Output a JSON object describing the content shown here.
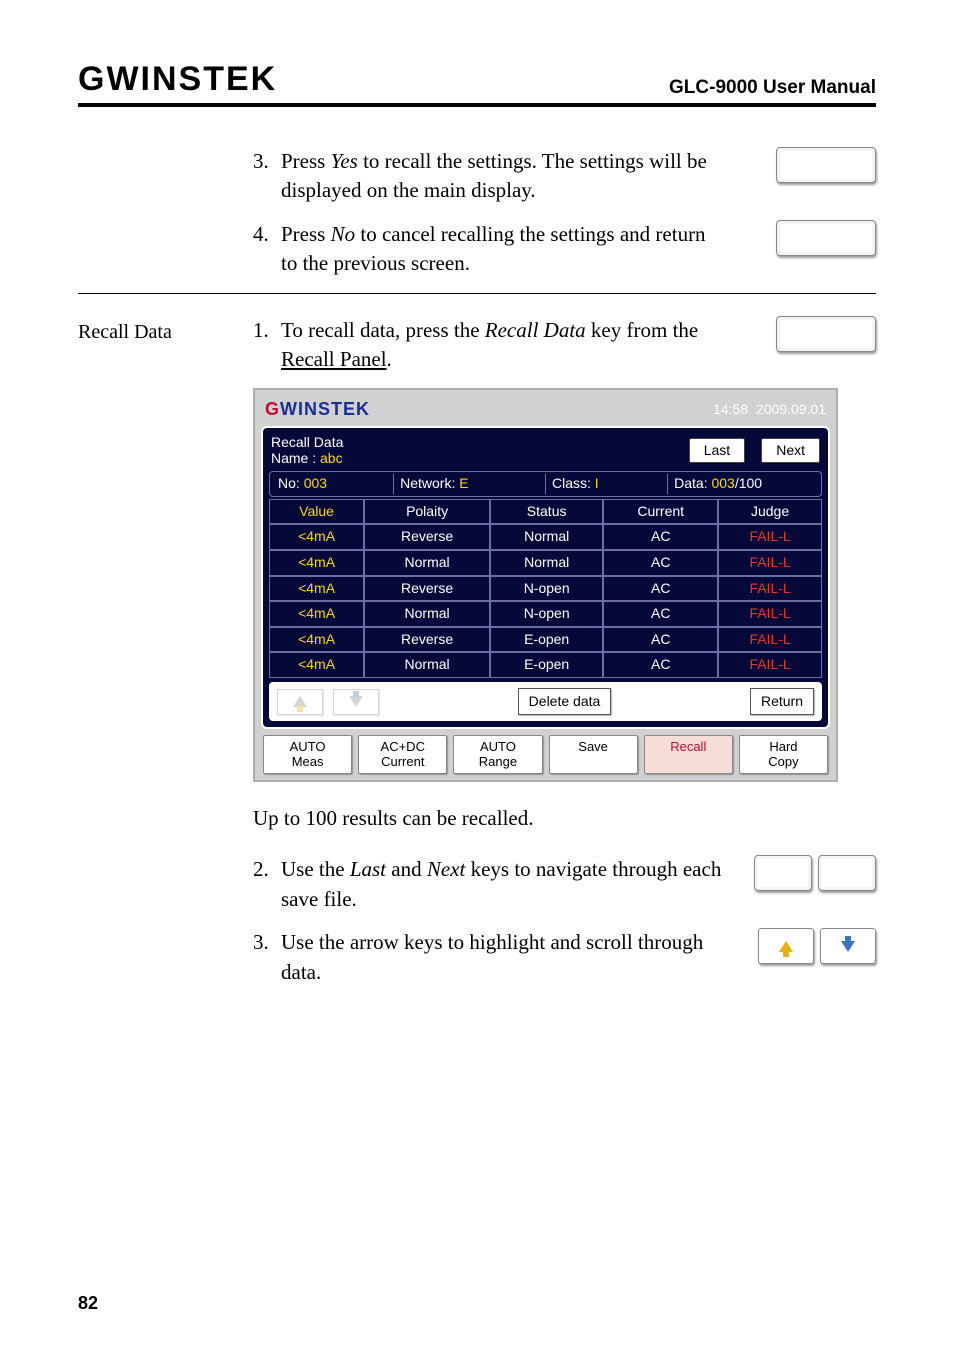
{
  "header": {
    "logo": "GWINSTEK",
    "manual": "GLC-9000 User Manual"
  },
  "step3": {
    "num": "3.",
    "text_a": "Press ",
    "yes": "Yes",
    "text_b": " to recall the settings. The settings will be displayed on the main display."
  },
  "step4": {
    "num": "4.",
    "text_a": "Press ",
    "no": "No",
    "text_b": " to cancel recalling the settings and return to the previous screen."
  },
  "recall_data_label": "Recall Data",
  "rd1": {
    "num": "1.",
    "text_a": "To recall data, press the ",
    "italic1": "Recall Data",
    "text_b": " key from the ",
    "ul": "Recall Panel",
    "text_c": "."
  },
  "device": {
    "brand_g": "G",
    "brand_w": "W",
    "brand_rest": "INSTEK",
    "time": "14:58",
    "date": "2009.09.01",
    "title1": "Recall Data",
    "title2_a": "Name : ",
    "title2_b": "abc",
    "last": "Last",
    "next": "Next",
    "info": {
      "no_a": "No: ",
      "no_b": "003",
      "net_a": "Network: ",
      "net_b": "E",
      "cls_a": "Class: ",
      "cls_b": "I",
      "data_a": "Data: ",
      "data_b": "003",
      "data_c": "/100"
    },
    "headers": [
      "Value",
      "Polaity",
      "Status",
      "Current",
      "Judge"
    ],
    "rows": [
      [
        "<4mA",
        "Reverse",
        "Normal",
        "AC",
        "FAIL-L"
      ],
      [
        "<4mA",
        "Normal",
        "Normal",
        "AC",
        "FAIL-L"
      ],
      [
        "<4mA",
        "Reverse",
        "N-open",
        "AC",
        "FAIL-L"
      ],
      [
        "<4mA",
        "Normal",
        "N-open",
        "AC",
        "FAIL-L"
      ],
      [
        "<4mA",
        "Reverse",
        "E-open",
        "AC",
        "FAIL-L"
      ],
      [
        "<4mA",
        "Normal",
        "E-open",
        "AC",
        "FAIL-L"
      ]
    ],
    "delete": "Delete data",
    "return": "Return",
    "bottom": [
      "AUTO\nMeas",
      "AC+DC\nCurrent",
      "AUTO\nRange",
      "Save",
      "Recall",
      "Hard\nCopy"
    ]
  },
  "note_recalled": "Up to 100 results can be recalled.",
  "rd2": {
    "num": "2.",
    "text_a": "Use the ",
    "it1": "Last",
    "text_b": " and ",
    "it2": "Next",
    "text_c": " keys to navigate through each save file."
  },
  "rd3": {
    "num": "3.",
    "text": "Use the arrow keys to highlight and scroll through data."
  },
  "page": "82"
}
